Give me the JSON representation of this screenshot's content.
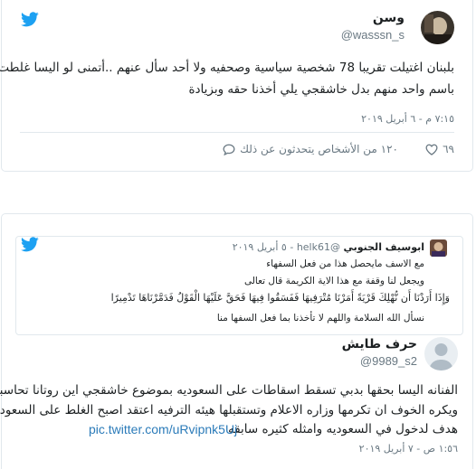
{
  "tweet1": {
    "author_name": "وسن",
    "author_handle": "@wasssn_s",
    "text_lines": [
      "بلبنان اغتيلت تقريبا 78 شخصية سياسية وصحفيه ولا أحد سأل عنهم ..أتمنى لو اليسا غلطت",
      "باسم واحد منهم بدل خاشقجي يلي أخذنا حقه وبزيادة"
    ],
    "timestamp": "٧:١٥ م - ٦ أبريل ٢٠١٩",
    "likes": "٦٩",
    "people_talking": "١٢٠ من الأشخاص يتحدثون عن ذلك"
  },
  "tweet2": {
    "quoted": {
      "author_name": "ابوسيف الجنوبي",
      "author_handle": "@helk61",
      "date": "٥ أبريل ٢٠١٩",
      "lines": [
        "مع الاسف مايحصل هذا من فعل السفهاء",
        "ويجعل لنا وقفة مع هذا الاية الكريمة قال تعالى",
        "وَإِذَا أَرَدْنَا أَن نُّهْلِكَ قَرْيَةً أَمَرْنَا مُتْرَفِيهَا فَفَسَقُوا فِيهَا فَحَقَّ عَلَيْهَا الْقَوْلُ فَدَمَّرْنَاهَا تَدْمِيرًا",
        "نسأل الله السلامة واللهم لا تأخذنا بما فعل السفها منا"
      ]
    },
    "author_name": "حرف طايش",
    "author_handle": "@9989_s2",
    "text_lines": [
      "الفنانه اليسا بحقها بدبي تسقط اسقاطات على السعوديه بموضوع خاشقجي اين روتانا تحاسبها",
      "ويكره الخوف ان تكرمها وزاره الاعلام وتستقبلها هيئه الترفيه اعتقد اصبح الغلط على السعوديه",
      "هدف لدخول في السعوديه وامثله كثيره سابقه"
    ],
    "link": "pic.twitter.com/uRvipnk5Uj",
    "timestamp": "١:٥٦ ص - ٧ أبريل ٢٠١٩"
  },
  "colors": {
    "twitter_blue": "#1da1f2",
    "link": "#2b7bb9",
    "muted": "#697882",
    "border": "#e1e8ed"
  }
}
